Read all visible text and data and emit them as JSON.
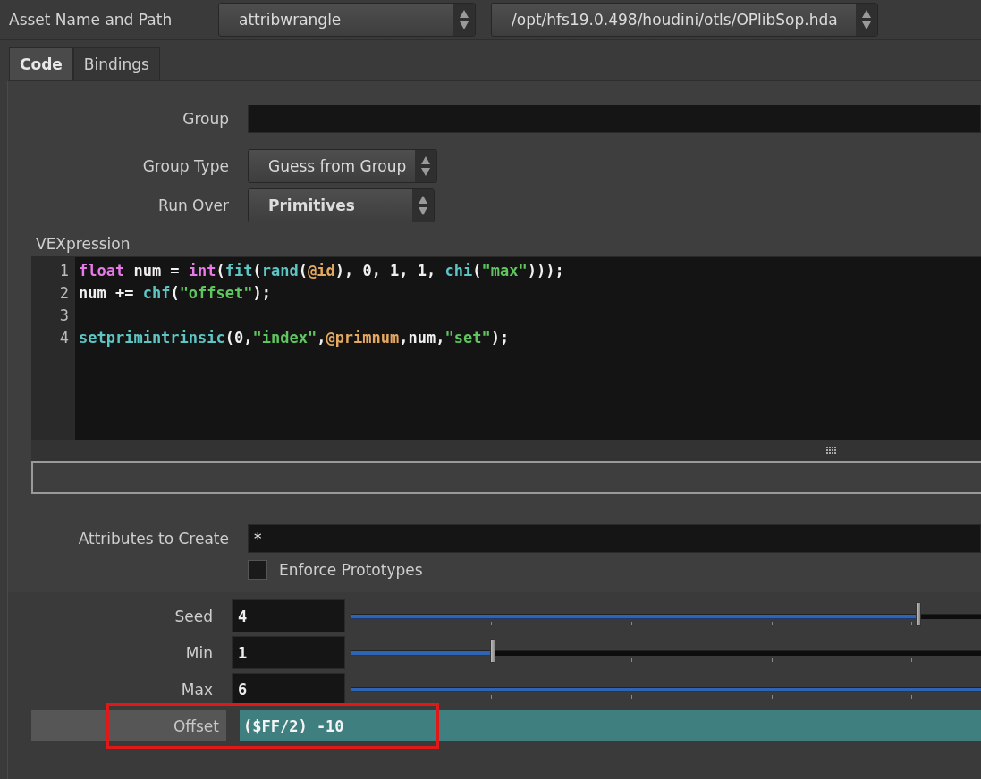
{
  "asset": {
    "label": "Asset Name and Path",
    "name": "attribwrangle",
    "path": "/opt/hfs19.0.498/houdini/otls/OPlibSop.hda"
  },
  "tabs": [
    {
      "label": "Code",
      "selected": true
    },
    {
      "label": "Bindings",
      "selected": false
    }
  ],
  "group": {
    "label": "Group"
  },
  "group_type": {
    "label": "Group Type",
    "value": "Guess from Group"
  },
  "run_over": {
    "label": "Run Over",
    "value": "Primitives"
  },
  "vexpression": {
    "label": "VEXpression",
    "lines": [
      {
        "number": "1",
        "tokens": [
          {
            "kind": "keyword",
            "text": "float"
          },
          {
            "kind": "plain",
            "text": " num = "
          },
          {
            "kind": "keyword",
            "text": "int"
          },
          {
            "kind": "plain",
            "text": "("
          },
          {
            "kind": "func",
            "text": "fit"
          },
          {
            "kind": "plain",
            "text": "("
          },
          {
            "kind": "func",
            "text": "rand"
          },
          {
            "kind": "plain",
            "text": "("
          },
          {
            "kind": "attr",
            "text": "@id"
          },
          {
            "kind": "plain",
            "text": "), 0, 1, 1, "
          },
          {
            "kind": "func",
            "text": "chi"
          },
          {
            "kind": "plain",
            "text": "("
          },
          {
            "kind": "string",
            "text": "\"max\""
          },
          {
            "kind": "plain",
            "text": ")));"
          }
        ]
      },
      {
        "number": "2",
        "tokens": [
          {
            "kind": "plain",
            "text": "num += "
          },
          {
            "kind": "func",
            "text": "chf"
          },
          {
            "kind": "plain",
            "text": "("
          },
          {
            "kind": "string",
            "text": "\"offset\""
          },
          {
            "kind": "plain",
            "text": ");"
          }
        ]
      },
      {
        "number": "3"
      },
      {
        "number": "4",
        "tokens": [
          {
            "kind": "func",
            "text": "setprimintrinsic"
          },
          {
            "kind": "plain",
            "text": "(0,"
          },
          {
            "kind": "string",
            "text": "\"index\""
          },
          {
            "kind": "plain",
            "text": ","
          },
          {
            "kind": "attr",
            "text": "@primnum"
          },
          {
            "kind": "plain",
            "text": ",num,"
          },
          {
            "kind": "string",
            "text": "\"set\""
          },
          {
            "kind": "plain",
            "text": ");"
          }
        ]
      }
    ]
  },
  "attributes_to_create": {
    "label": "Attributes to Create",
    "value": "*"
  },
  "enforce_prototypes": {
    "label": "Enforce Prototypes",
    "checked": false
  },
  "sliders": [
    {
      "label": "Seed",
      "value": "4",
      "level": 0.9
    },
    {
      "label": "Min",
      "value": "1",
      "level": 0.226
    },
    {
      "label": "Max",
      "value": "6",
      "level": 1
    }
  ],
  "offset": {
    "label": "Offset",
    "value": "($FF/2) -10",
    "highlighted": true
  }
}
